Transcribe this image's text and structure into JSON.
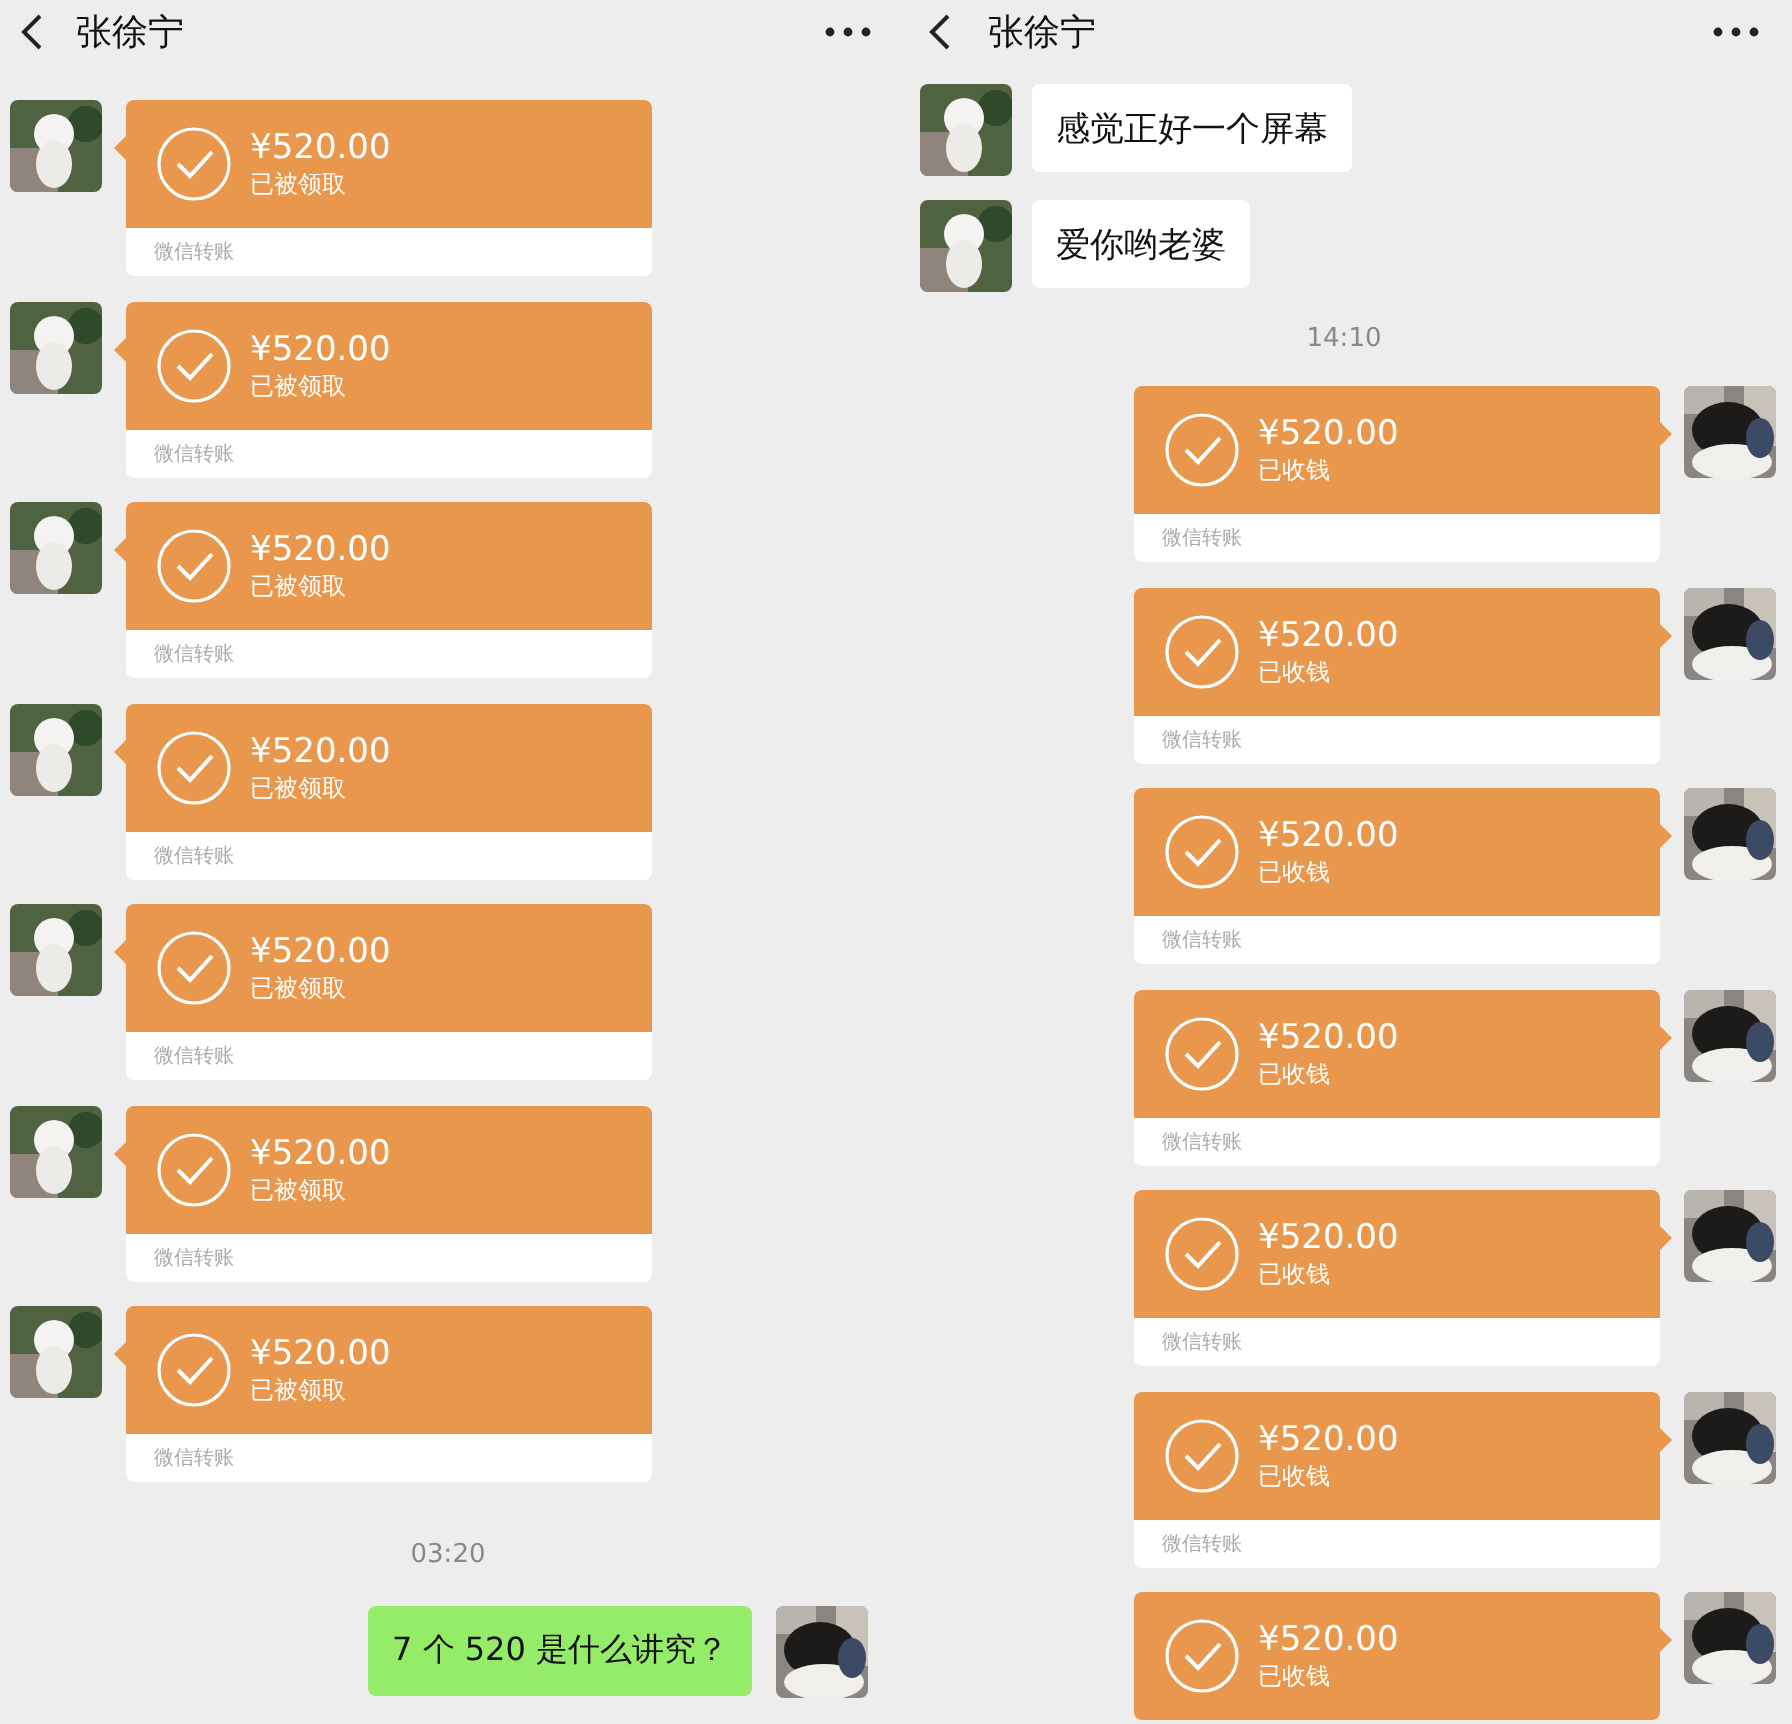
{
  "panels": [
    {
      "title": "张徐宁",
      "messages": [
        {
          "kind": "transfer",
          "outgoing": false,
          "amount": "¥520.00",
          "status": "已被领取",
          "footer": "微信转账"
        },
        {
          "kind": "transfer",
          "outgoing": false,
          "amount": "¥520.00",
          "status": "已被领取",
          "footer": "微信转账"
        },
        {
          "kind": "transfer",
          "outgoing": false,
          "amount": "¥520.00",
          "status": "已被领取",
          "footer": "微信转账"
        },
        {
          "kind": "transfer",
          "outgoing": false,
          "amount": "¥520.00",
          "status": "已被领取",
          "footer": "微信转账"
        },
        {
          "kind": "transfer",
          "outgoing": false,
          "amount": "¥520.00",
          "status": "已被领取",
          "footer": "微信转账"
        },
        {
          "kind": "transfer",
          "outgoing": false,
          "amount": "¥520.00",
          "status": "已被领取",
          "footer": "微信转账"
        },
        {
          "kind": "transfer",
          "outgoing": false,
          "amount": "¥520.00",
          "status": "已被领取",
          "footer": "微信转账"
        },
        {
          "kind": "time",
          "text": "03:20"
        },
        {
          "kind": "text",
          "outgoing": true,
          "text": "7 个 520 是什么讲究？"
        }
      ]
    },
    {
      "title": "张徐宁",
      "messages": [
        {
          "kind": "text",
          "outgoing": false,
          "text": "感觉正好一个屏幕"
        },
        {
          "kind": "text",
          "outgoing": false,
          "text": "爱你哟老婆"
        },
        {
          "kind": "time",
          "text": "14:10"
        },
        {
          "kind": "transfer",
          "outgoing": true,
          "amount": "¥520.00",
          "status": "已收钱",
          "footer": "微信转账"
        },
        {
          "kind": "transfer",
          "outgoing": true,
          "amount": "¥520.00",
          "status": "已收钱",
          "footer": "微信转账"
        },
        {
          "kind": "transfer",
          "outgoing": true,
          "amount": "¥520.00",
          "status": "已收钱",
          "footer": "微信转账"
        },
        {
          "kind": "transfer",
          "outgoing": true,
          "amount": "¥520.00",
          "status": "已收钱",
          "footer": "微信转账"
        },
        {
          "kind": "transfer",
          "outgoing": true,
          "amount": "¥520.00",
          "status": "已收钱",
          "footer": "微信转账"
        },
        {
          "kind": "transfer",
          "outgoing": true,
          "amount": "¥520.00",
          "status": "已收钱",
          "footer": "微信转账"
        },
        {
          "kind": "transfer",
          "outgoing": true,
          "amount": "¥520.00",
          "status": "已收钱"
        }
      ]
    }
  ]
}
